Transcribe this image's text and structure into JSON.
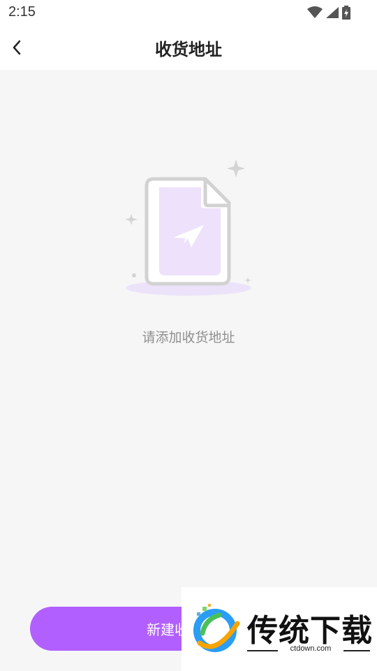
{
  "status_bar": {
    "time": "2:15"
  },
  "header": {
    "title": "收货地址"
  },
  "empty_state": {
    "message": "请添加收货地址"
  },
  "footer": {
    "add_button_label": "新建收货地址"
  },
  "watermark": {
    "brand": "传统下载",
    "domain": "ctdown.com"
  },
  "colors": {
    "accent": "#b160ff",
    "illustration_fill": "#ede1fb",
    "background": "#f6f6f6"
  }
}
